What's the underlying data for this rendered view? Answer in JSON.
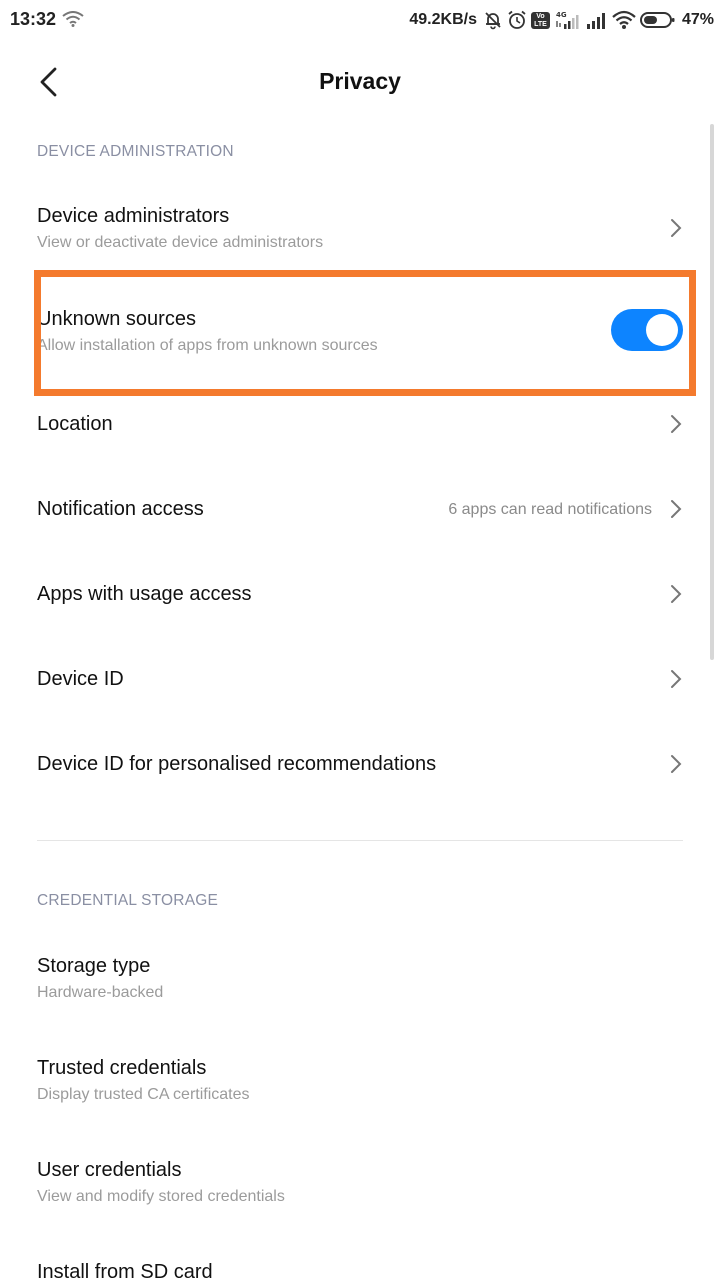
{
  "status_bar": {
    "time": "13:32",
    "net_speed": "49.2KB/s",
    "volte_label": "Vo LTE",
    "signal_label": "4G",
    "battery_pct": "47%"
  },
  "header": {
    "title": "Privacy"
  },
  "sections": {
    "device_admin_header": "DEVICE ADMINISTRATION",
    "credential_header": "CREDENTIAL STORAGE"
  },
  "items": {
    "device_administrators": {
      "title": "Device administrators",
      "subtitle": "View or deactivate device administrators"
    },
    "unknown_sources": {
      "title": "Unknown sources",
      "subtitle": "Allow installation of apps from unknown sources",
      "enabled": true
    },
    "location": {
      "title": "Location"
    },
    "notification_access": {
      "title": "Notification access",
      "value": "6 apps can read notifications"
    },
    "usage_access": {
      "title": "Apps with usage access"
    },
    "device_id": {
      "title": "Device ID"
    },
    "device_id_recs": {
      "title": "Device ID for personalised recommendations"
    },
    "storage_type": {
      "title": "Storage type",
      "subtitle": "Hardware-backed"
    },
    "trusted_credentials": {
      "title": "Trusted credentials",
      "subtitle": "Display trusted CA certificates"
    },
    "user_credentials": {
      "title": "User credentials",
      "subtitle": "View and modify stored credentials"
    },
    "install_sd": {
      "title": "Install from SD card"
    }
  },
  "colors": {
    "accent": "#0d84ff",
    "highlight": "#f47a2d",
    "section_header": "#8a8fa3"
  }
}
